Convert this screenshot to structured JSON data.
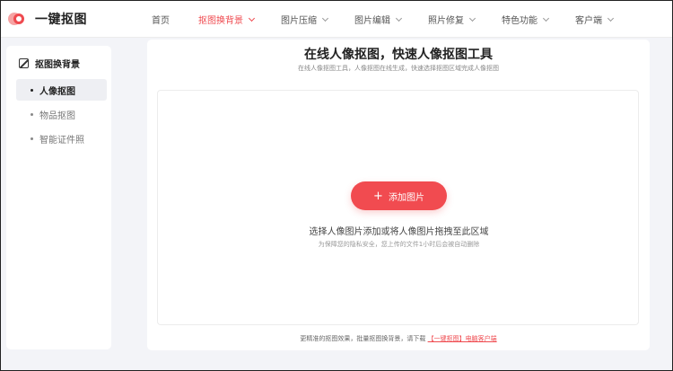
{
  "header": {
    "logo_text": "一键抠图",
    "nav": [
      {
        "label": "首页"
      },
      {
        "label": "抠图换背景"
      },
      {
        "label": "图片压缩"
      },
      {
        "label": "图片编辑"
      },
      {
        "label": "照片修复"
      },
      {
        "label": "特色功能"
      },
      {
        "label": "客户端"
      }
    ],
    "active_color": "#ef4a4f"
  },
  "sidebar": {
    "title": "抠图换背景",
    "items": [
      {
        "label": "人像抠图"
      },
      {
        "label": "物品抠图"
      },
      {
        "label": "智能证件照"
      }
    ]
  },
  "main": {
    "title": "在线人像抠图，快速人像抠图工具",
    "subtitle": "在线人像抠图工具，人像抠图在线生成，快速选择抠图区域完成人像抠图",
    "add_button": "添加图片",
    "hint": "选择人像图片添加或将人像图片拖拽至此区域",
    "privacy": "为保障您的隐私安全，您上传的文件1小时后会被自动删除",
    "footer_text": "更精准的抠图效果，批量抠图换背景，请下载",
    "footer_link": "【一键抠图】电脑客户端",
    "button_color": "#f14b50"
  }
}
